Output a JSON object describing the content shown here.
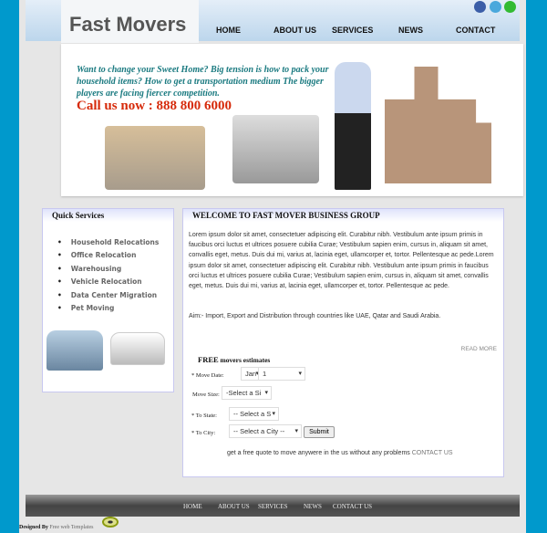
{
  "header": {
    "logo": "Fast Movers",
    "nav": [
      "HOME",
      "ABOUT US",
      "SERVICES",
      "NEWS",
      "CONTACT"
    ],
    "social": [
      "facebook",
      "twitter",
      "vine"
    ]
  },
  "banner": {
    "tagline": "Want to change your Sweet Home? Big tension is how to pack your household items? How to get a transportation medium The bigger players are facing fiercer competition.",
    "call": "Call us now : 888 800 6000"
  },
  "quick": {
    "title": "Quick Services",
    "items": [
      "Household Relocations",
      "Office Relocation",
      "Warehousing",
      "Vehicle Relocation",
      "Data Center Migration",
      "Pet Moving"
    ]
  },
  "main": {
    "title": "WELCOME TO FAST MOVER BUSINESS GROUP",
    "body": "Lorem ipsum dolor sit amet, consectetuer adipiscing elit. Curabitur nibh. Vestibulum ante ipsum primis in faucibus orci luctus et ultrices posuere cubilia Curae; Vestibulum sapien enim, cursus in, aliquam sit amet, convallis eget, metus. Duis dui mi, varius at, lacinia eget, ullamcorper et, tortor. Pellentesque ac pede.Lorem ipsum dolor sit amet, consectetuer adipiscing elit. Curabitur nibh. Vestibulum ante ipsum primis in faucibus orci luctus et ultrices posuere cubilia Curae; Vestibulum sapien enim, cursus in, aliquam sit amet, convallis eget, metus. Duis dui mi, varius at, lacinia eget, ullamcorper et, tortor. Pellentesque ac pede.",
    "aim": "Aim:- Import, Export and Distribution through countries like UAE, Qatar and Saudi Arabia.",
    "read_more": "READ MORE"
  },
  "form": {
    "title_bold": "FREE",
    "title_rest": " movers estimates",
    "move_date": "* Move Date:",
    "month": "Jan",
    "day": "1",
    "move_size": "Move Size:",
    "size": "-Select a Si",
    "to_state": "* To State:",
    "state": "-- Select a S",
    "to_city": "* To City:",
    "city": "-- Select a City --",
    "submit": "Submit",
    "quote": "get a free quote to move anywere in the us without any problems",
    "contact": "CONTACT US"
  },
  "footer": {
    "nav": [
      "HOME",
      "ABOUT US",
      "SERVICES",
      "NEWS",
      "CONTACT US"
    ],
    "designed_by": "Designed By",
    "designer": "Free web Templates"
  }
}
